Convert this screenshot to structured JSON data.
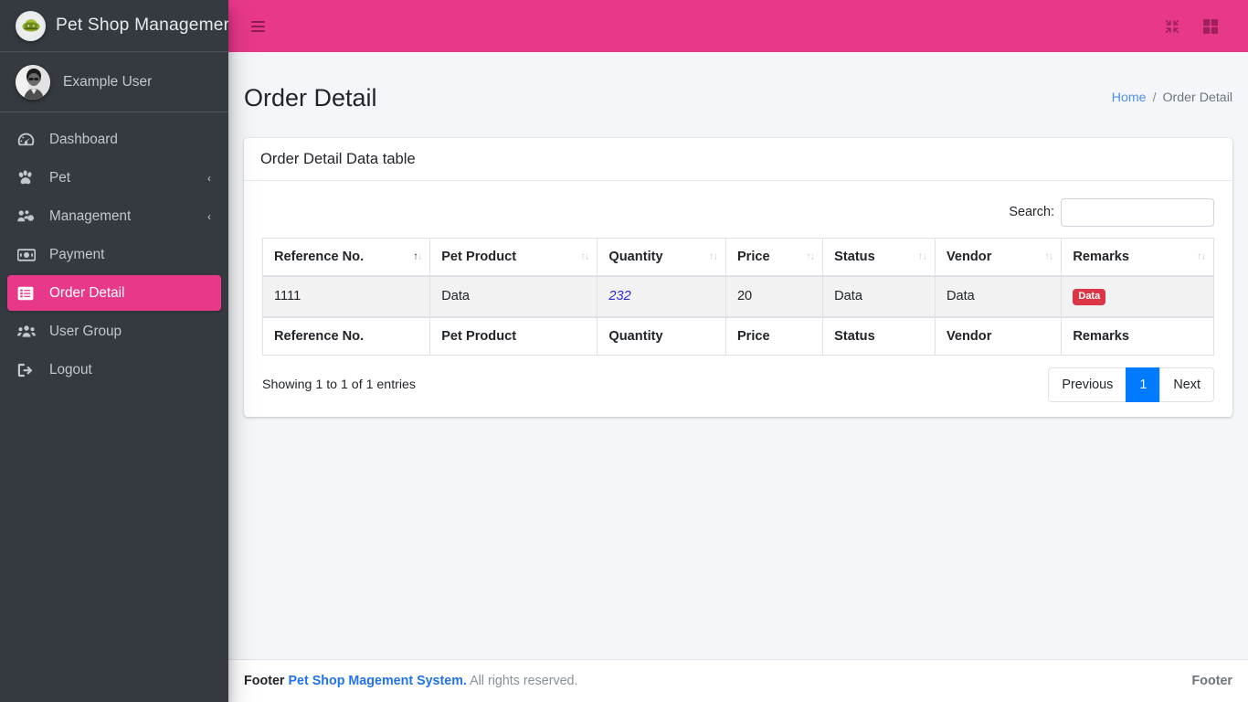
{
  "sidebar": {
    "brand": {
      "title": "Pet Shop Management",
      "logo_icon": "paw-circle-logo"
    },
    "user": {
      "name": "Example User",
      "avatar_icon": "user-avatar"
    },
    "items": [
      {
        "label": "Dashboard",
        "icon": "tachometer-icon",
        "active": false,
        "caret": ""
      },
      {
        "label": "Pet",
        "icon": "paw-icon",
        "active": false,
        "caret": "‹"
      },
      {
        "label": "Management",
        "icon": "users-cog-icon",
        "active": false,
        "caret": "‹"
      },
      {
        "label": "Payment",
        "icon": "money-bill-icon",
        "active": false,
        "caret": ""
      },
      {
        "label": "Order Detail",
        "icon": "list-alt-icon",
        "active": true,
        "caret": ""
      },
      {
        "label": "User Group",
        "icon": "users-icon",
        "active": false,
        "caret": ""
      },
      {
        "label": "Logout",
        "icon": "sign-out-icon",
        "active": false,
        "caret": ""
      }
    ]
  },
  "topbar": {
    "menu_toggle_icon": "hamburger-icon",
    "fullscreen_icon": "compress-icon",
    "grid_icon": "th-large-icon",
    "accent_color": "#e8388a"
  },
  "header": {
    "title": "Order Detail",
    "breadcrumb": {
      "home": "Home",
      "separator": "/",
      "current": "Order Detail"
    }
  },
  "card": {
    "title": "Order Detail Data table"
  },
  "datatable": {
    "search_label": "Search:",
    "search_value": "",
    "search_placeholder": "",
    "columns": [
      {
        "label": "Reference No.",
        "sorted": "asc"
      },
      {
        "label": "Pet Product",
        "sorted": "none"
      },
      {
        "label": "Quantity",
        "sorted": "none"
      },
      {
        "label": "Price",
        "sorted": "none"
      },
      {
        "label": "Status",
        "sorted": "none"
      },
      {
        "label": "Vendor",
        "sorted": "none"
      },
      {
        "label": "Remarks",
        "sorted": "none"
      }
    ],
    "rows": [
      {
        "reference_no": "1111",
        "pet_product": "Data",
        "quantity": "232",
        "price": "20",
        "status": "Data",
        "vendor": "Data",
        "remarks": "Data"
      }
    ],
    "footer_columns": [
      "Reference No.",
      "Pet Product",
      "Quantity",
      "Price",
      "Status",
      "Vendor",
      "Remarks"
    ],
    "info": "Showing 1 to 1 of 1 entries",
    "pagination": {
      "previous": "Previous",
      "pages": [
        "1"
      ],
      "current_page": "1",
      "next": "Next",
      "active_color": "#007bff"
    },
    "badge_color": "#dc3545",
    "link_color": "#2c2cd6"
  },
  "footer": {
    "prefix": "Footer",
    "brand": "Pet Shop Magement System.",
    "rights": "All rights reserved.",
    "right_text": "Footer"
  }
}
